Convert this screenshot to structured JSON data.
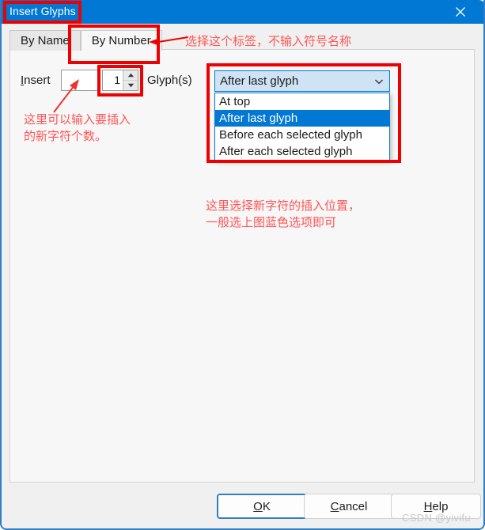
{
  "window": {
    "title": "Insert Glyphs",
    "close_icon": "close-icon",
    "accent_color": "#0078d4",
    "border_color": "#2f7fc6"
  },
  "tabs": [
    {
      "label": "By Name",
      "selected": false
    },
    {
      "label": "By Number",
      "selected": true
    }
  ],
  "form": {
    "insert_label_prefix": "I",
    "insert_label_rest": "nsert",
    "name_value": "",
    "spinner_value": "1",
    "spinner_up_icon": "triangle-up-icon",
    "spinner_down_icon": "triangle-down-icon",
    "glyphs_label": "Glyph(s)"
  },
  "combobox": {
    "selected_value": "After last glyph",
    "arrow_icon": "chevron-down-icon",
    "options": [
      {
        "label": "At top",
        "highlighted": false
      },
      {
        "label": "After last glyph",
        "highlighted": true
      },
      {
        "label": "Before each selected glyph",
        "highlighted": false
      },
      {
        "label": "After each selected glyph",
        "highlighted": false
      }
    ]
  },
  "annotations": {
    "color": "#ff5555",
    "box_color": "#ee0000",
    "tab_note": "选择这个标签，不输入符号名称",
    "spin_note_line1": "这里可以输入要插入",
    "spin_note_line2": "的新字符个数。",
    "combo_note_line1": "这里选择新字符的插入位置，",
    "combo_note_line2": "一般选上图蓝色选项即可"
  },
  "footer": {
    "ok": {
      "accel": "O",
      "rest": "K"
    },
    "cancel": {
      "accel": "C",
      "rest": "ancel"
    },
    "help": {
      "accel": "H",
      "rest": "elp"
    }
  },
  "watermark": "CSDN @yivifu"
}
